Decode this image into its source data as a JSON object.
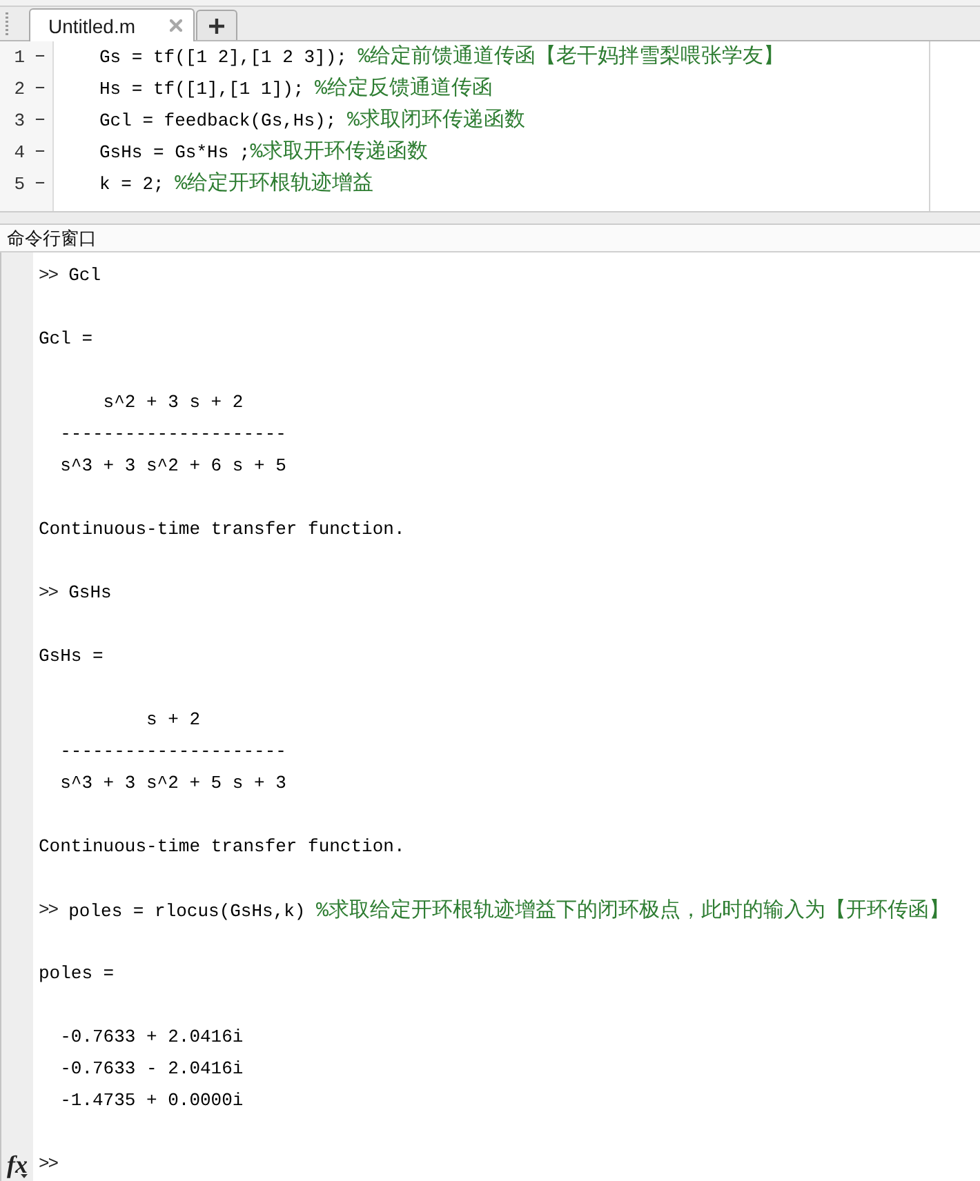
{
  "editor": {
    "tabs": [
      {
        "label": "Untitled.m",
        "selected": true
      }
    ],
    "lines": [
      {
        "number": "1",
        "marker": "—",
        "code": "Gs = tf([1 2],[1 2 3]); ",
        "comment": "%给定前馈通道传函【老干妈拌雪梨喂张学友】"
      },
      {
        "number": "2",
        "marker": "—",
        "code": "Hs = tf([1],[1 1]); ",
        "comment": "%给定反馈通道传函"
      },
      {
        "number": "3",
        "marker": "—",
        "code": "Gcl = feedback(Gs,Hs); ",
        "comment": "%求取闭环传递函数"
      },
      {
        "number": "4",
        "marker": "—",
        "code": "GsHs = Gs*Hs ;",
        "comment": "%求取开环传递函数"
      },
      {
        "number": "5",
        "marker": "—",
        "code": "k = 2; ",
        "comment": "%给定开环根轨迹增益"
      }
    ]
  },
  "command_window": {
    "title": "命令行窗口",
    "blocks": [
      {
        "kind": "command",
        "prompt": ">>",
        "code": "Gcl"
      },
      {
        "kind": "text",
        "text": "Gcl ="
      },
      {
        "kind": "fraction",
        "numerator": "s^2 + 3 s + 2",
        "bar": "---------------------",
        "denominator": "s^3 + 3 s^2 + 6 s + 5"
      },
      {
        "kind": "text",
        "text": "Continuous-time transfer function."
      },
      {
        "kind": "command",
        "prompt": ">>",
        "code": "GsHs"
      },
      {
        "kind": "text",
        "text": "GsHs ="
      },
      {
        "kind": "fraction",
        "numerator": "s + 2",
        "bar": "---------------------",
        "denominator": "s^3 + 3 s^2 + 5 s + 3"
      },
      {
        "kind": "text",
        "text": "Continuous-time transfer function."
      },
      {
        "kind": "command",
        "prompt": ">>",
        "code": "poles = rlocus(GsHs,k) ",
        "comment": "%求取给定开环根轨迹增益下的闭环极点，此时的输入为【开环传函】"
      },
      {
        "kind": "text",
        "text": "poles ="
      },
      {
        "kind": "matrix",
        "rows": [
          "-0.7633 + 2.0416i",
          "-0.7633 - 2.0416i",
          "-1.4735 + 0.0000i"
        ]
      }
    ],
    "function_browser": "fx",
    "prompt": ">>"
  }
}
